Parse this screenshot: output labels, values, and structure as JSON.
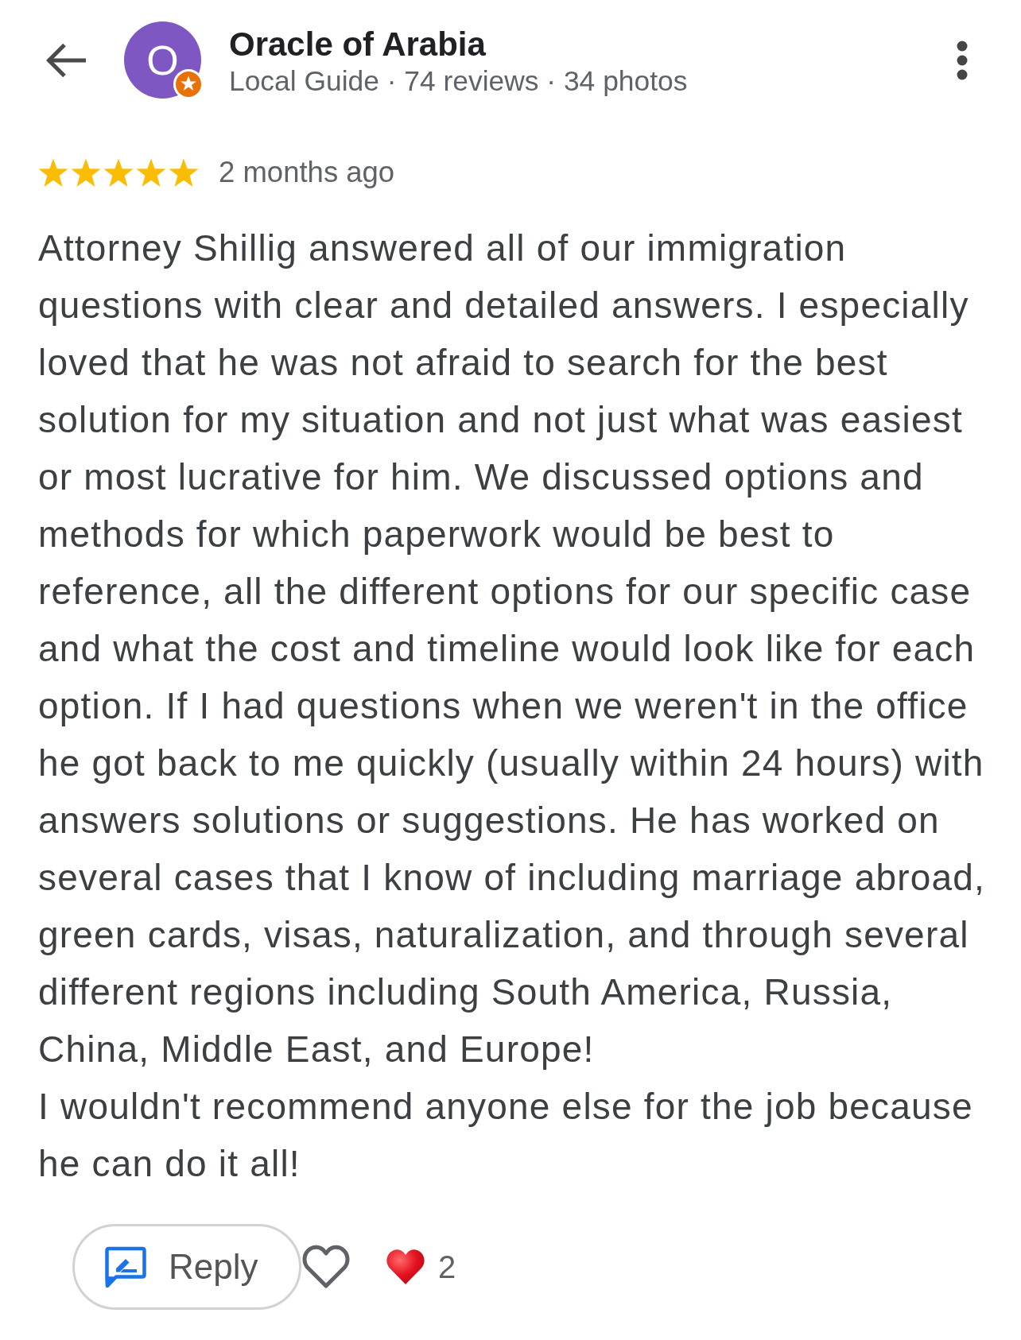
{
  "reviewer": {
    "initial": "O",
    "name": "Oracle of Arabia",
    "stats": "Local Guide · 74 reviews · 34 photos"
  },
  "review": {
    "stars": 5,
    "time": "2 months ago",
    "paragraphs": [
      "Attorney Shillig answered all of our immigration questions with clear and detailed answers. I especially loved that he was not afraid to search for the best solution for my situation and not just what was easiest or most lucrative for him. We discussed options and methods for which paperwork would be best to reference, all the different options for our specific case and what the cost and timeline would look like for each option. If I had questions when we weren't in the office he got back to me quickly (usually within 24 hours) with answers solutions or suggestions. He has worked on several cases that I know of including marriage abroad, green cards, visas, naturalization, and through several different regions including South America, Russia, China, Middle East, and Europe!",
      "I wouldn't recommend anyone else for the job because he can do it all!"
    ]
  },
  "actions": {
    "reply": "Reply",
    "liked": false,
    "reaction_count": "2"
  }
}
